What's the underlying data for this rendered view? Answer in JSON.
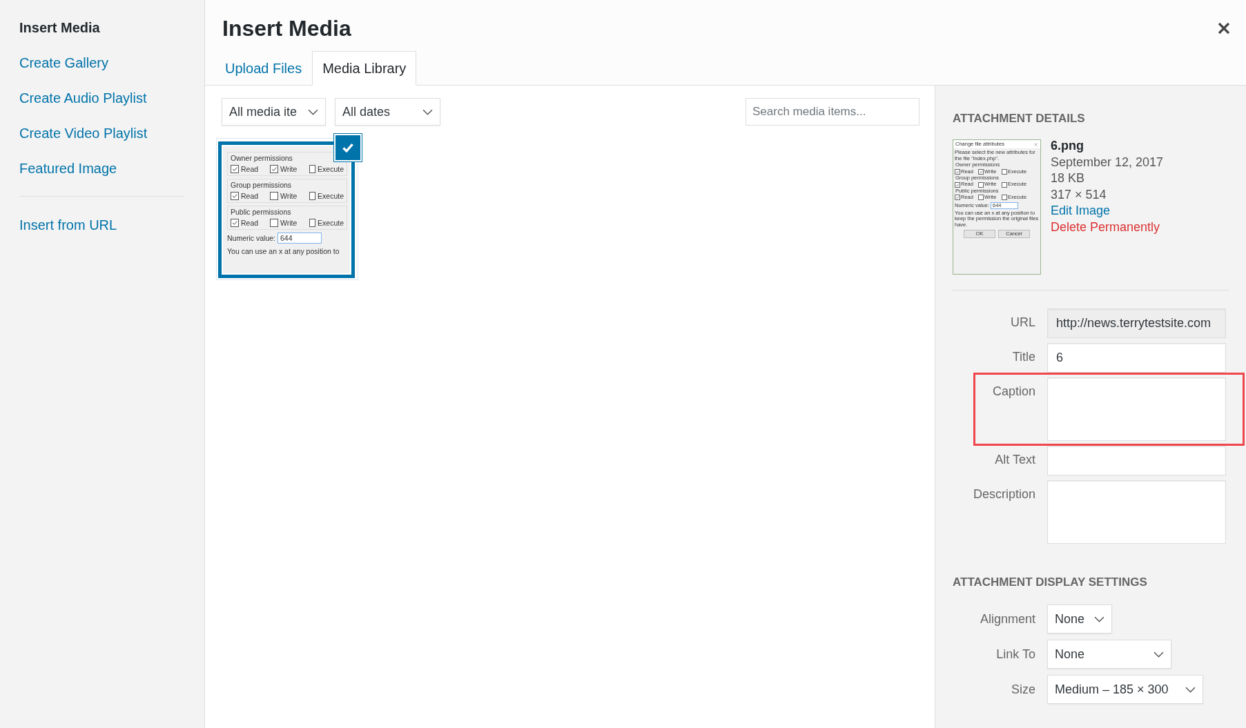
{
  "menu": [
    {
      "label": "Insert Media",
      "selected": true
    },
    {
      "label": "Create Gallery",
      "selected": false
    },
    {
      "label": "Create Audio Playlist",
      "selected": false
    },
    {
      "label": "Create Video Playlist",
      "selected": false
    },
    {
      "label": "Featured Image",
      "selected": false
    }
  ],
  "menu_extra": [
    {
      "label": "Insert from URL",
      "selected": false
    }
  ],
  "header": {
    "title": "Insert Media"
  },
  "tabs": [
    {
      "label": "Upload Files",
      "selected": false
    },
    {
      "label": "Media Library",
      "selected": true
    }
  ],
  "filters": {
    "type": "All media ite",
    "date": "All dates",
    "search_placeholder": "Search media items..."
  },
  "attachments": [
    {
      "selected": true,
      "preview": {
        "groups": [
          {
            "title": "Owner permissions",
            "options": [
              {
                "label": "Read",
                "checked": true
              },
              {
                "label": "Write",
                "checked": true
              },
              {
                "label": "Execute",
                "checked": false
              }
            ]
          },
          {
            "title": "Group permissions",
            "options": [
              {
                "label": "Read",
                "checked": true
              },
              {
                "label": "Write",
                "checked": false
              },
              {
                "label": "Execute",
                "checked": false
              }
            ]
          },
          {
            "title": "Public permissions",
            "options": [
              {
                "label": "Read",
                "checked": true
              },
              {
                "label": "Write",
                "checked": false
              },
              {
                "label": "Execute",
                "checked": false
              }
            ]
          }
        ],
        "numeric_label": "Numeric value:",
        "numeric_value": "644",
        "note": "You can use an x at any position to"
      }
    }
  ],
  "details": {
    "heading": "ATTACHMENT DETAILS",
    "thumbnail": {
      "title": "Change file attributes",
      "prompt": "Please select the new attributes for the file \"index.php\".",
      "groups": [
        {
          "title": "Owner permissions",
          "options": [
            {
              "label": "Read",
              "checked": true
            },
            {
              "label": "Write",
              "checked": true
            },
            {
              "label": "Execute",
              "checked": false
            }
          ]
        },
        {
          "title": "Group permissions",
          "options": [
            {
              "label": "Read",
              "checked": true
            },
            {
              "label": "Write",
              "checked": false
            },
            {
              "label": "Execute",
              "checked": false
            }
          ]
        },
        {
          "title": "Public permissions",
          "options": [
            {
              "label": "Read",
              "checked": true
            },
            {
              "label": "Write",
              "checked": false
            },
            {
              "label": "Execute",
              "checked": false
            }
          ]
        }
      ],
      "numeric_label": "Numeric value:",
      "numeric_value": "644",
      "note": "You can use an x at any position to keep the permission the original files have.",
      "buttons": [
        "OK",
        "Cancel"
      ]
    },
    "filename": "6.png",
    "date": "September 12, 2017",
    "size": "18 KB",
    "dimensions": "317 × 514",
    "edit_link": "Edit Image",
    "delete_link": "Delete Permanently",
    "fields": [
      {
        "label": "URL",
        "value": "http://news.terrytestsite.com",
        "kind": "readonly",
        "highlighted": false
      },
      {
        "label": "Title",
        "value": "6",
        "kind": "text",
        "highlighted": false
      },
      {
        "label": "Caption",
        "kind": "textarea",
        "highlighted": true
      },
      {
        "label": "Alt Text",
        "kind": "text",
        "highlighted": false
      },
      {
        "label": "Description",
        "kind": "textarea",
        "highlighted": false
      }
    ]
  },
  "display_settings": {
    "heading": "ATTACHMENT DISPLAY SETTINGS",
    "selects": [
      {
        "label": "Alignment",
        "value": "None",
        "kind": "short"
      },
      {
        "label": "Link To",
        "value": "None",
        "kind": "medium"
      },
      {
        "label": "Size",
        "value": "Medium – 185 × 300",
        "kind": "long"
      }
    ]
  }
}
